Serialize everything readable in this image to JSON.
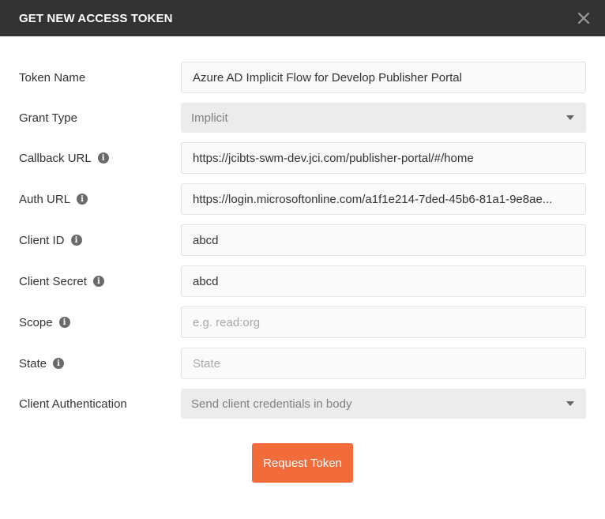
{
  "header": {
    "title": "GET NEW ACCESS TOKEN",
    "close_icon": "close-icon"
  },
  "fields": {
    "token_name": {
      "label": "Token Name",
      "value": "Azure AD Implicit Flow for Develop Publisher Portal"
    },
    "grant_type": {
      "label": "Grant Type",
      "value": "Implicit"
    },
    "callback_url": {
      "label": "Callback URL",
      "value": "https://jcibts-swm-dev.jci.com/publisher-portal/#/home"
    },
    "auth_url": {
      "label": "Auth URL",
      "value": "https://login.microsoftonline.com/a1f1e214-7ded-45b6-81a1-9e8ae..."
    },
    "client_id": {
      "label": "Client ID",
      "value": "abcd"
    },
    "client_secret": {
      "label": "Client Secret",
      "value": "abcd"
    },
    "scope": {
      "label": "Scope",
      "value": "",
      "placeholder": "e.g. read:org"
    },
    "state": {
      "label": "State",
      "value": "",
      "placeholder": "State"
    },
    "client_authentication": {
      "label": "Client Authentication",
      "value": "Send client credentials in body"
    }
  },
  "info_glyph": "i",
  "actions": {
    "request_token": "Request Token"
  },
  "colors": {
    "header_bg": "#333333",
    "accent": "#f26b3a"
  }
}
